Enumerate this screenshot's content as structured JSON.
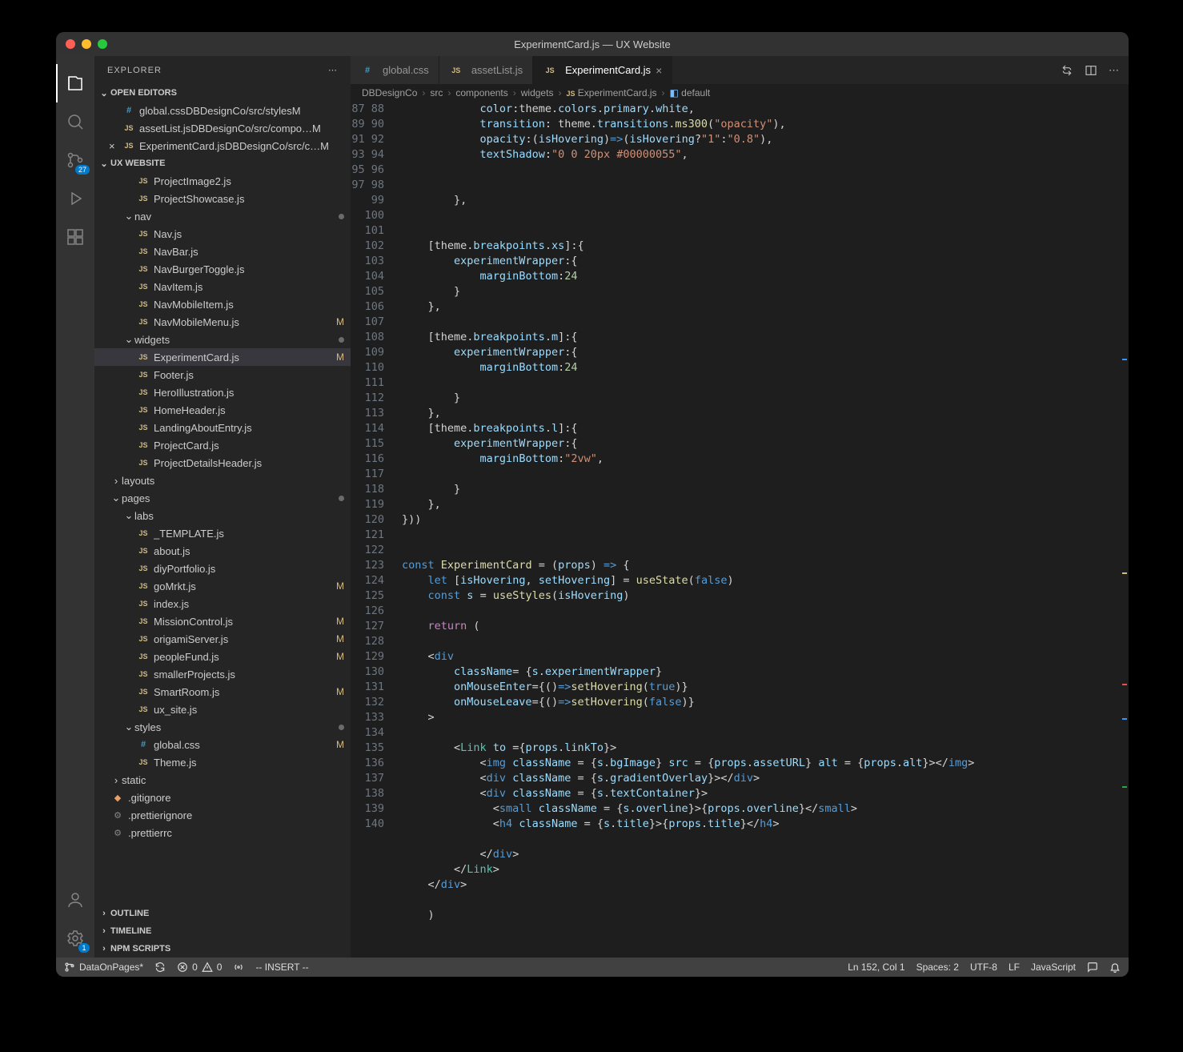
{
  "window_title": "ExperimentCard.js — UX Website",
  "sidebar": {
    "title": "EXPLORER",
    "sections": {
      "open_editors": "OPEN EDITORS",
      "workspace": "UX WEBSITE",
      "outline": "OUTLINE",
      "timeline": "TIMELINE",
      "npm": "NPM SCRIPTS"
    },
    "open_editors_list": [
      {
        "icon": "css",
        "name": "global.css",
        "path": "DBDesignCo/src/styles",
        "mod": "M"
      },
      {
        "icon": "js",
        "name": "assetList.js",
        "path": "DBDesignCo/src/compo…",
        "mod": "M"
      },
      {
        "icon": "js",
        "name": "ExperimentCard.js",
        "path": "DBDesignCo/src/c…",
        "mod": "M",
        "active": true
      }
    ],
    "tree": [
      {
        "indent": 2,
        "type": "file",
        "icon": "js",
        "name": "ProjectImage2.js"
      },
      {
        "indent": 2,
        "type": "file",
        "icon": "js",
        "name": "ProjectShowcase.js"
      },
      {
        "indent": 1,
        "type": "folder",
        "open": true,
        "name": "nav",
        "udot": true
      },
      {
        "indent": 2,
        "type": "file",
        "icon": "js",
        "name": "Nav.js"
      },
      {
        "indent": 2,
        "type": "file",
        "icon": "js",
        "name": "NavBar.js"
      },
      {
        "indent": 2,
        "type": "file",
        "icon": "js",
        "name": "NavBurgerToggle.js"
      },
      {
        "indent": 2,
        "type": "file",
        "icon": "js",
        "name": "NavItem.js"
      },
      {
        "indent": 2,
        "type": "file",
        "icon": "js",
        "name": "NavMobileItem.js"
      },
      {
        "indent": 2,
        "type": "file",
        "icon": "js",
        "name": "NavMobileMenu.js",
        "mod": "M"
      },
      {
        "indent": 1,
        "type": "folder",
        "open": true,
        "name": "widgets",
        "udot": true
      },
      {
        "indent": 2,
        "type": "file",
        "icon": "js",
        "name": "ExperimentCard.js",
        "mod": "M",
        "selected": true
      },
      {
        "indent": 2,
        "type": "file",
        "icon": "js",
        "name": "Footer.js"
      },
      {
        "indent": 2,
        "type": "file",
        "icon": "js",
        "name": "HeroIllustration.js"
      },
      {
        "indent": 2,
        "type": "file",
        "icon": "js",
        "name": "HomeHeader.js"
      },
      {
        "indent": 2,
        "type": "file",
        "icon": "js",
        "name": "LandingAboutEntry.js"
      },
      {
        "indent": 2,
        "type": "file",
        "icon": "js",
        "name": "ProjectCard.js"
      },
      {
        "indent": 2,
        "type": "file",
        "icon": "js",
        "name": "ProjectDetailsHeader.js"
      },
      {
        "indent": 0,
        "type": "folder",
        "open": false,
        "name": "layouts"
      },
      {
        "indent": 0,
        "type": "folder",
        "open": true,
        "name": "pages",
        "udot": true
      },
      {
        "indent": 1,
        "type": "folder",
        "open": true,
        "name": "labs"
      },
      {
        "indent": 2,
        "type": "file",
        "icon": "js",
        "name": "_TEMPLATE.js"
      },
      {
        "indent": 2,
        "type": "file",
        "icon": "js",
        "name": "about.js"
      },
      {
        "indent": 2,
        "type": "file",
        "icon": "js",
        "name": "diyPortfolio.js"
      },
      {
        "indent": 2,
        "type": "file",
        "icon": "js",
        "name": "goMrkt.js",
        "mod": "M"
      },
      {
        "indent": 2,
        "type": "file",
        "icon": "js",
        "name": "index.js"
      },
      {
        "indent": 2,
        "type": "file",
        "icon": "js",
        "name": "MissionControl.js",
        "mod": "M"
      },
      {
        "indent": 2,
        "type": "file",
        "icon": "js",
        "name": "origamiServer.js",
        "mod": "M"
      },
      {
        "indent": 2,
        "type": "file",
        "icon": "js",
        "name": "peopleFund.js",
        "mod": "M"
      },
      {
        "indent": 2,
        "type": "file",
        "icon": "js",
        "name": "smallerProjects.js"
      },
      {
        "indent": 2,
        "type": "file",
        "icon": "js",
        "name": "SmartRoom.js",
        "mod": "M"
      },
      {
        "indent": 2,
        "type": "file",
        "icon": "js",
        "name": "ux_site.js"
      },
      {
        "indent": 1,
        "type": "folder",
        "open": true,
        "name": "styles",
        "udot": true
      },
      {
        "indent": 2,
        "type": "file",
        "icon": "css",
        "name": "global.css",
        "mod": "M"
      },
      {
        "indent": 2,
        "type": "file",
        "icon": "js",
        "name": "Theme.js"
      },
      {
        "indent": 0,
        "type": "folder",
        "open": false,
        "name": "static"
      },
      {
        "indent": 0,
        "type": "file",
        "icon": "git",
        "name": ".gitignore"
      },
      {
        "indent": 0,
        "type": "file",
        "icon": "cfg",
        "name": ".prettierignore"
      },
      {
        "indent": 0,
        "type": "file",
        "icon": "cfg",
        "name": ".prettierrc"
      }
    ]
  },
  "tabs": [
    {
      "icon": "css",
      "label": "global.css"
    },
    {
      "icon": "js",
      "label": "assetList.js"
    },
    {
      "icon": "js",
      "label": "ExperimentCard.js",
      "active": true
    }
  ],
  "breadcrumbs": [
    "DBDesignCo",
    "src",
    "components",
    "widgets",
    "ExperimentCard.js",
    "default"
  ],
  "code": {
    "first_line": 87,
    "lines": [
      "            <span class='tok-prop'>color</span>:theme.<span class='tok-prop'>colors</span>.<span class='tok-prop'>primary</span>.<span class='tok-prop'>white</span>,",
      "            <span class='tok-prop'>transition</span>: theme.<span class='tok-prop'>transitions</span>.<span class='tok-fn'>ms300</span>(<span class='tok-str'>\"opacity\"</span>),",
      "            <span class='tok-prop'>opacity</span>:(<span class='tok-var'>isHovering</span>)<span class='tok-key'>=&gt;</span>(<span class='tok-var'>isHovering</span>?<span class='tok-str'>\"1\"</span>:<span class='tok-str'>\"0.8\"</span>),",
      "            <span class='tok-prop'>textShadow</span>:<span class='tok-str'>\"0 0 20px #00000055\"</span>,",
      "",
      "",
      "        },",
      "",
      "",
      "    [theme.<span class='tok-prop'>breakpoints</span>.<span class='tok-prop'>xs</span>]:{",
      "        <span class='tok-prop'>experimentWrapper</span>:{",
      "            <span class='tok-prop'>marginBottom</span>:<span class='tok-num'>24</span>",
      "        }",
      "    },",
      "",
      "    [theme.<span class='tok-prop'>breakpoints</span>.<span class='tok-prop'>m</span>]:{",
      "        <span class='tok-prop'>experimentWrapper</span>:{",
      "            <span class='tok-prop'>marginBottom</span>:<span class='tok-num'>24</span>",
      "",
      "        }",
      "    },",
      "    [theme.<span class='tok-prop'>breakpoints</span>.<span class='tok-prop'>l</span>]:{",
      "        <span class='tok-prop'>experimentWrapper</span>:{",
      "            <span class='tok-prop'>marginBottom</span>:<span class='tok-str'>\"2vw\"</span>,",
      "",
      "        }",
      "    },",
      "}))",
      "",
      "",
      "<span class='tok-key'>const</span> <span class='tok-fn'>ExperimentCard</span> = (<span class='tok-var'>props</span>) <span class='tok-key'>=&gt;</span> {",
      "    <span class='tok-key'>let</span> [<span class='tok-var'>isHovering</span>, <span class='tok-var'>setHovering</span>] = <span class='tok-fn'>useState</span>(<span class='tok-key'>false</span>)",
      "    <span class='tok-key'>const</span> <span class='tok-var'>s</span> = <span class='tok-fn'>useStyles</span>(<span class='tok-var'>isHovering</span>)",
      "",
      "    <span class='tok-key2'>return</span> (",
      "",
      "    &lt;<span class='tok-tag'>div</span>",
      "        <span class='tok-attr'>className</span>= {<span class='tok-var'>s</span>.<span class='tok-prop'>experimentWrapper</span>}",
      "        <span class='tok-attr'>onMouseEnter</span>={()<span class='tok-key'>=&gt;</span><span class='tok-fn'>setHovering</span>(<span class='tok-key'>true</span>)}",
      "        <span class='tok-attr'>onMouseLeave</span>={()<span class='tok-key'>=&gt;</span><span class='tok-fn'>setHovering</span>(<span class='tok-key'>false</span>)}",
      "    &gt;",
      "",
      "        &lt;<span class='tok-comp'>Link</span> <span class='tok-attr'>to</span> ={<span class='tok-var'>props</span>.<span class='tok-prop'>linkTo</span>}&gt;",
      "            &lt;<span class='tok-tag'>img</span> <span class='tok-attr'>className</span> = {<span class='tok-var'>s</span>.<span class='tok-prop'>bgImage</span>} <span class='tok-attr'>src</span> = {<span class='tok-var'>props</span>.<span class='tok-prop'>assetURL</span>} <span class='tok-attr'>alt</span> = {<span class='tok-var'>props</span>.<span class='tok-prop'>alt</span>}&gt;&lt;/<span class='tok-tag'>img</span>&gt;",
      "            &lt;<span class='tok-tag'>div</span> <span class='tok-attr'>className</span> = {<span class='tok-var'>s</span>.<span class='tok-prop'>gradientOverlay</span>}&gt;&lt;/<span class='tok-tag'>div</span>&gt;",
      "            &lt;<span class='tok-tag'>div</span> <span class='tok-attr'>className</span> = {<span class='tok-var'>s</span>.<span class='tok-prop'>textContainer</span>}&gt;",
      "              &lt;<span class='tok-tag'>small</span> <span class='tok-attr'>className</span> = {<span class='tok-var'>s</span>.<span class='tok-prop'>overline</span>}&gt;{<span class='tok-var'>props</span>.<span class='tok-prop'>overline</span>}&lt;/<span class='tok-tag'>small</span>&gt;",
      "              &lt;<span class='tok-tag'>h4</span> <span class='tok-attr'>className</span> = {<span class='tok-var'>s</span>.<span class='tok-prop'>title</span>}&gt;{<span class='tok-var'>props</span>.<span class='tok-prop'>title</span>}&lt;/<span class='tok-tag'>h4</span>&gt;",
      "",
      "            &lt;/<span class='tok-tag'>div</span>&gt;",
      "        &lt;/<span class='tok-comp'>Link</span>&gt;",
      "    &lt;/<span class='tok-tag'>div</span>&gt;",
      "",
      "    )"
    ]
  },
  "statusbar": {
    "branch": "DataOnPages*",
    "sync": "⟲",
    "errors": "0",
    "warnings": "0",
    "mode": "-- INSERT --",
    "position": "Ln 152, Col 1",
    "spaces": "Spaces: 2",
    "encoding": "UTF-8",
    "eol": "LF",
    "language": "JavaScript"
  },
  "activitybar": {
    "scm_badge": "27",
    "gear_badge": "1"
  }
}
